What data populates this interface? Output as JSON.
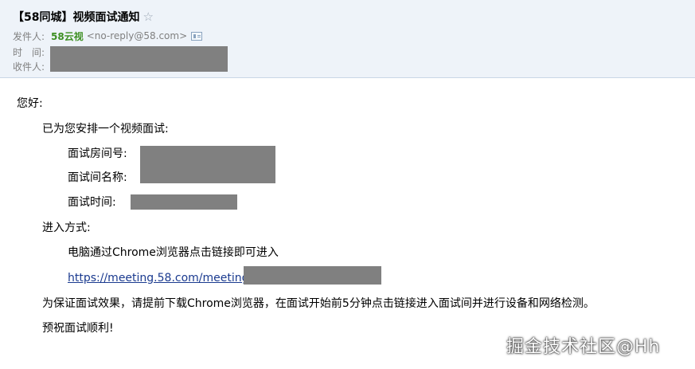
{
  "email": {
    "subject": "【58同城】视频面试通知",
    "star_icon": "star-outline-icon",
    "from_label": "发件人:",
    "sender_name": "58云视",
    "sender_email": "<no-reply@58.com>",
    "contact_icon": "contact-card-icon",
    "time_label": "时　间:",
    "to_label": "收件人:"
  },
  "body": {
    "greeting": "您好:",
    "intro": "已为您安排一个视频面试:",
    "room_number_label": "面试房间号:",
    "room_name_label": "面试间名称:",
    "interview_time_label": "面试时间:",
    "entry_method_label": "进入方式:",
    "entry_instruction": "电脑通过Chrome浏览器点击链接即可进入",
    "meeting_link": "https://meeting.58.com/meeting",
    "notice": "为保证面试效果，请提前下载Chrome浏览器，在面试开始前5分钟点击链接进入面试间并进行设备和网络检测。",
    "closing": "预祝面试顺利!"
  },
  "watermark": {
    "text": "掘金技术社区@Hh"
  }
}
